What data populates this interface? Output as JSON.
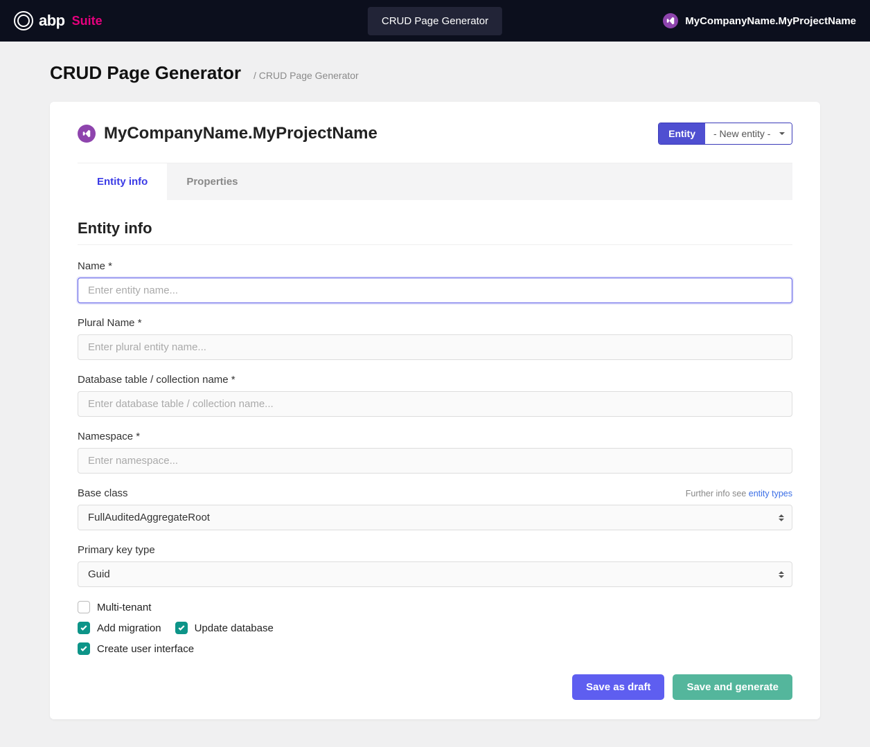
{
  "nav": {
    "logo_main": "abp",
    "logo_suffix": "Suite",
    "center_button": "CRUD Page Generator",
    "project_name": "MyCompanyName.MyProjectName"
  },
  "header": {
    "title": "CRUD Page Generator",
    "breadcrumb": "/ CRUD Page Generator"
  },
  "project": {
    "name": "MyCompanyName.MyProjectName",
    "entity_label": "Entity",
    "entity_selected": "- New entity -"
  },
  "tabs": {
    "entity_info": "Entity info",
    "properties": "Properties"
  },
  "form": {
    "section_title": "Entity info",
    "name": {
      "label": "Name *",
      "placeholder": "Enter entity name...",
      "value": ""
    },
    "plural": {
      "label": "Plural Name *",
      "placeholder": "Enter plural entity name...",
      "value": ""
    },
    "table": {
      "label": "Database table / collection name *",
      "placeholder": "Enter database table / collection name...",
      "value": ""
    },
    "namespace": {
      "label": "Namespace *",
      "placeholder": "Enter namespace...",
      "value": ""
    },
    "base_class": {
      "label": "Base class",
      "value": "FullAuditedAggregateRoot",
      "hint_prefix": "Further info see ",
      "hint_link": "entity types"
    },
    "pk": {
      "label": "Primary key type",
      "value": "Guid"
    },
    "checks": {
      "multi_tenant": {
        "label": "Multi-tenant",
        "checked": false
      },
      "add_migration": {
        "label": "Add migration",
        "checked": true
      },
      "update_db": {
        "label": "Update database",
        "checked": true
      },
      "create_ui": {
        "label": "Create user interface",
        "checked": true
      }
    }
  },
  "actions": {
    "draft": "Save as draft",
    "generate": "Save and generate"
  }
}
